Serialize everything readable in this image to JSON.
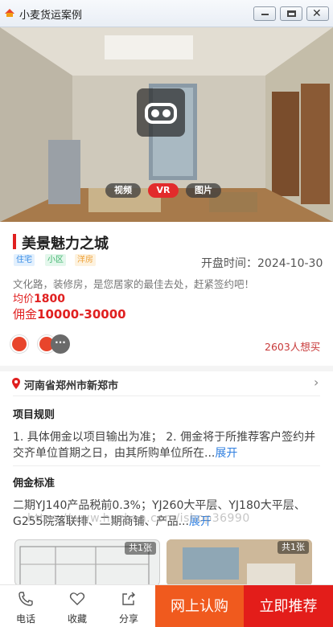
{
  "window": {
    "title": "小麦货运案例"
  },
  "media": {
    "tabs": [
      "视频",
      "VR",
      "图片"
    ],
    "active_tab": "VR"
  },
  "property": {
    "name": "美景魅力之城",
    "tags": [
      "住宅",
      "小区",
      "洋房"
    ],
    "open_date_label": "开盘时间：2024-10-30",
    "description": "文化路，装修房，是您居家的最佳去处，赶紧签约吧！",
    "price_label": "均价",
    "price_value": "1800",
    "commission_label": "佣金",
    "commission_value": "10000-30000",
    "wanted_count": "2603人想买",
    "more_avatars": "···"
  },
  "location": {
    "address": "河南省郑州市新郑市",
    "chevron": "›"
  },
  "rules": {
    "title": "项目规则",
    "text": "1. 具体佣金以项目输出为准； 2. 佣金将于所推荐客户签约并交齐单位首期之日，由其所购单位所在...",
    "more": "展开"
  },
  "commission_standard": {
    "title": "佣金标准",
    "text": "二期YJ140产品税前0.3%；YJ260大平层、YJ180大平层、G255院落联排、二期商铺、产品...",
    "more": "展开"
  },
  "watermark": "https://www.huzhan.com/ishop36990",
  "photos": [
    {
      "count": "共1张"
    },
    {
      "count": "共1张"
    }
  ],
  "bottom_bar": {
    "phone": "电话",
    "favorite": "收藏",
    "share": "分享",
    "online_purchase": "网上认购",
    "recommend": "立即推荐"
  },
  "colors": {
    "accent_red": "#e31d1a",
    "accent_orange": "#f05a1e",
    "link_blue": "#2f7fe0"
  }
}
